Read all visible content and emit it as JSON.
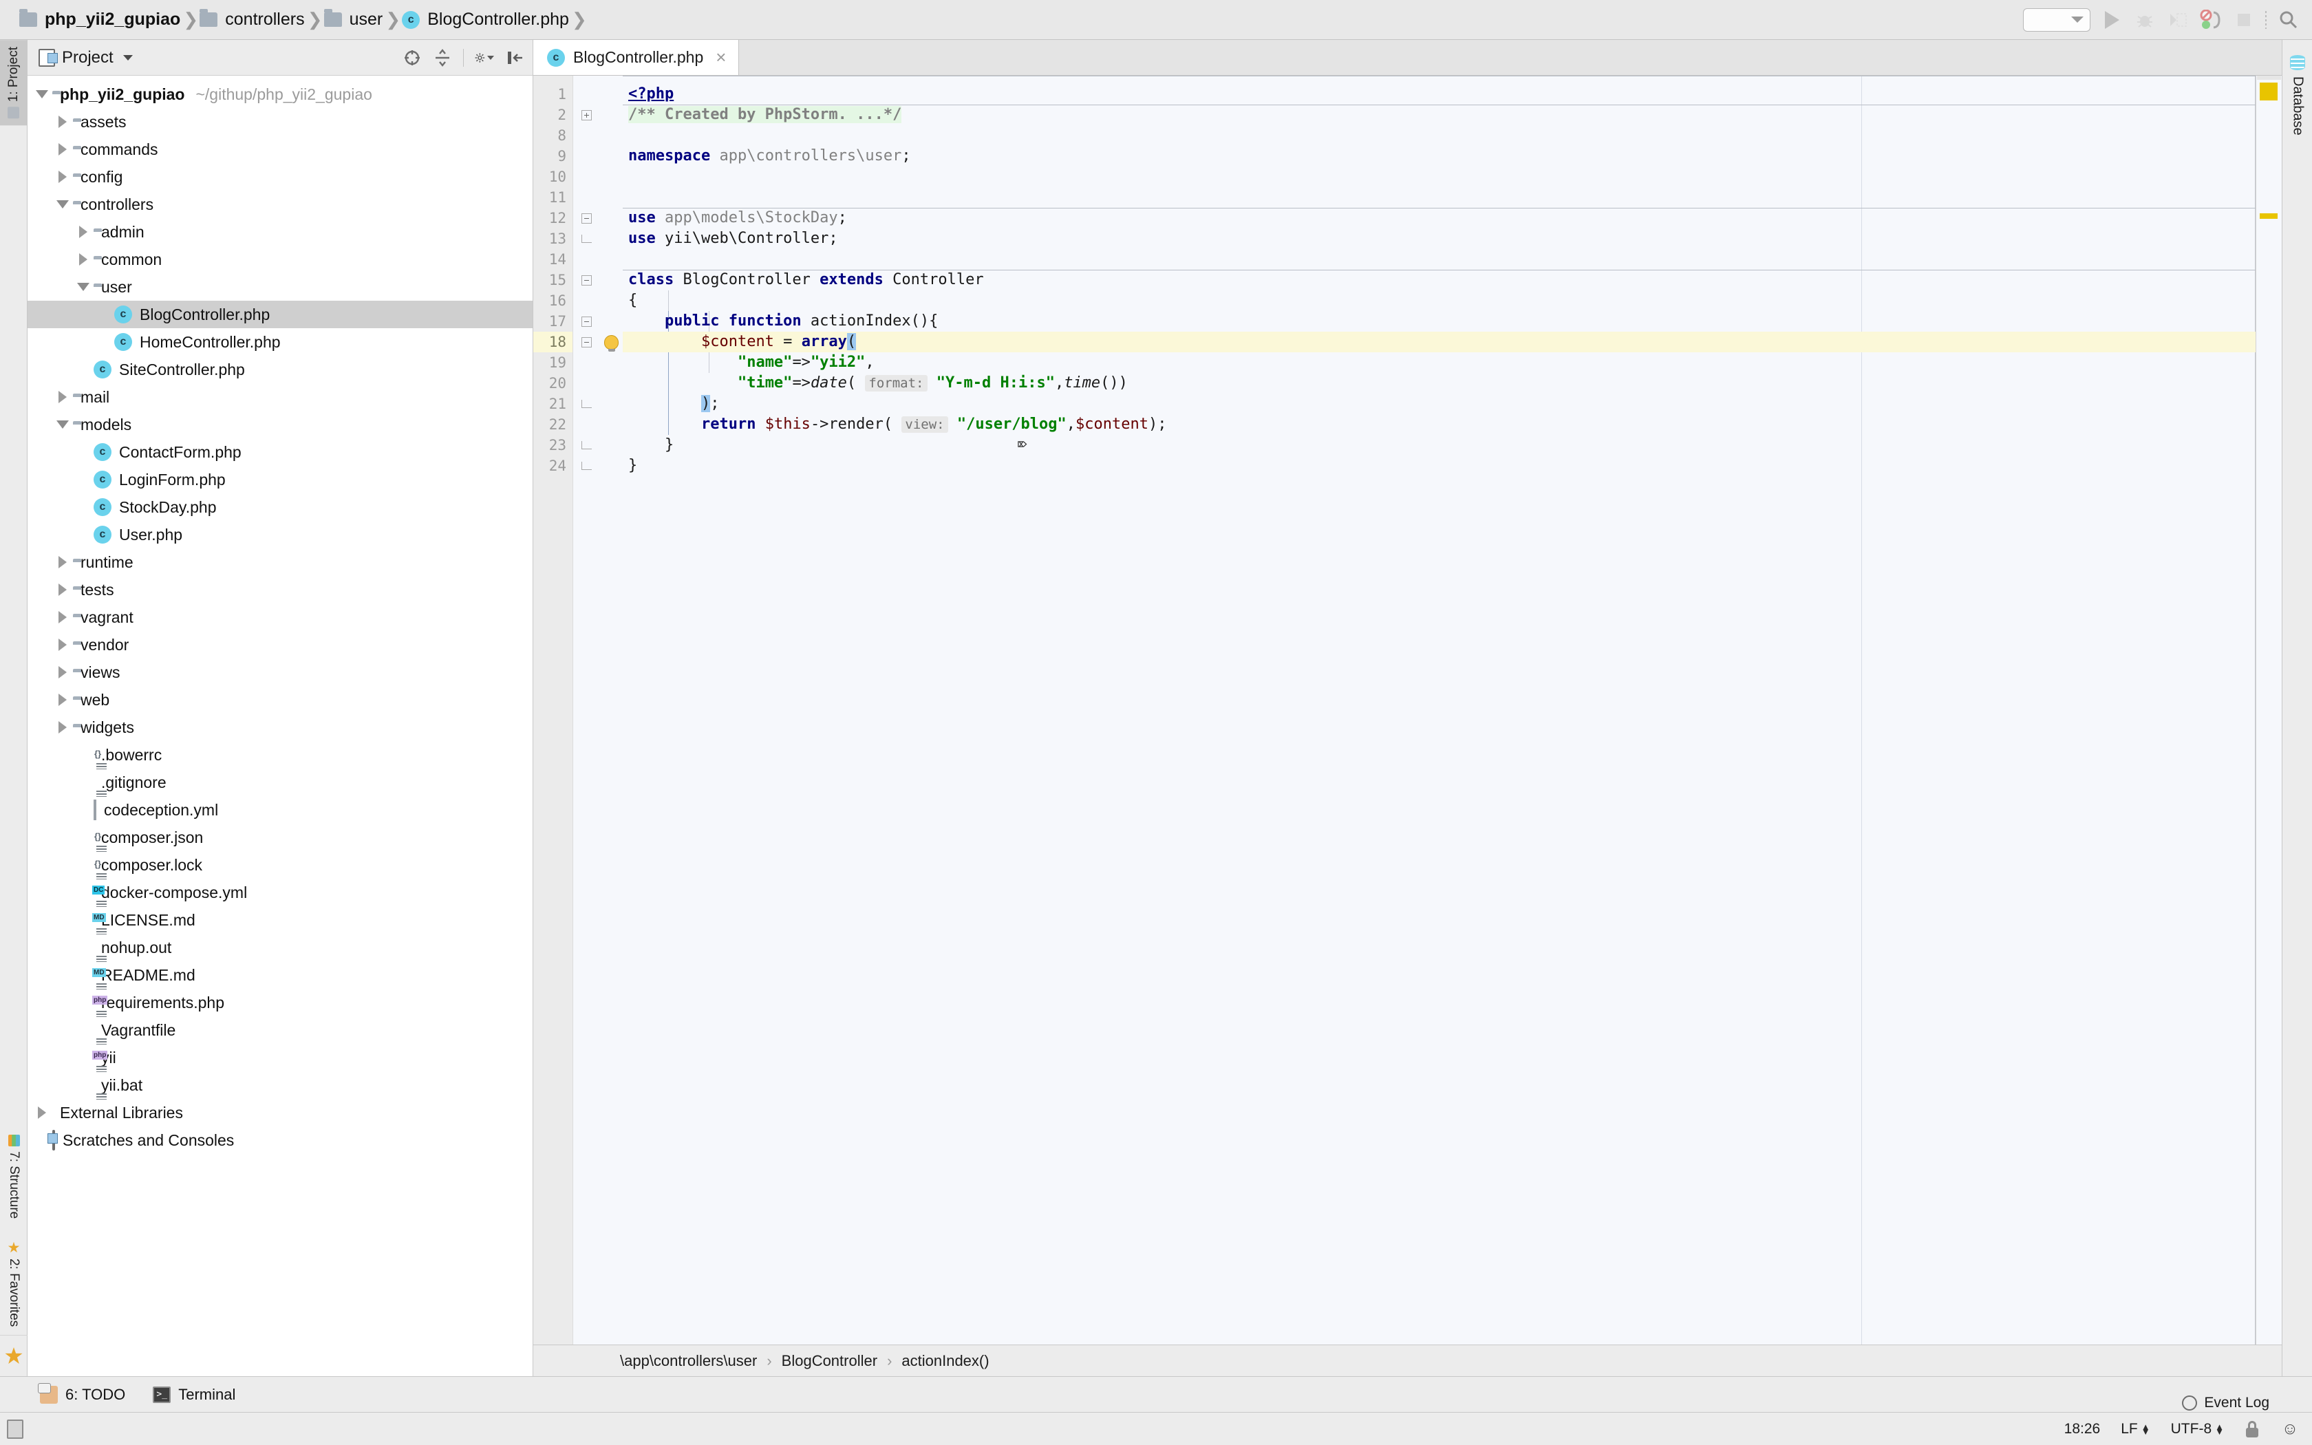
{
  "window": {
    "breadcrumb": [
      {
        "label": "php_yii2_gupiao",
        "icon": "folder-icon",
        "root": true
      },
      {
        "label": "controllers",
        "icon": "folder-icon"
      },
      {
        "label": "user",
        "icon": "folder-icon"
      },
      {
        "label": "BlogController.php",
        "icon": "php-class-icon"
      }
    ]
  },
  "toolbar": {
    "run_config_placeholder": "",
    "buttons": [
      {
        "name": "run-button",
        "label": "Run"
      },
      {
        "name": "debug-button",
        "label": "Debug"
      },
      {
        "name": "run-with-coverage-button",
        "label": "Run with Coverage"
      },
      {
        "name": "stop-debugger-button",
        "label": "Stop Listening for PHP Debug Connections"
      },
      {
        "name": "stop-button",
        "label": "Stop"
      },
      {
        "name": "search-everywhere-button",
        "label": "Search Everywhere"
      }
    ]
  },
  "left_strip": {
    "tabs": [
      {
        "label": "1: Project",
        "icon": "project-icon",
        "active": true
      },
      {
        "label": "7: Structure",
        "icon": "structure-icon",
        "active": false
      },
      {
        "label": "2: Favorites",
        "icon": "favorites-icon",
        "active": false
      }
    ],
    "bookmark_icon": "star-icon"
  },
  "right_strip": {
    "tabs": [
      {
        "label": "Database",
        "icon": "database-icon"
      }
    ]
  },
  "project_panel": {
    "title": "Project",
    "tools": [
      {
        "name": "scroll-from-source-button",
        "label": "Select Opened File"
      },
      {
        "name": "collapse-all-button",
        "label": "Collapse All"
      },
      {
        "name": "settings-gear-button",
        "label": "Settings"
      },
      {
        "name": "hide-panel-button",
        "label": "Hide"
      }
    ],
    "tree": [
      {
        "label": "php_yii2_gupiao",
        "sub": "~/githup/php_yii2_gupiao",
        "indent": 0,
        "twisty": "down",
        "icon": "folder-icon",
        "root": true
      },
      {
        "label": "assets",
        "indent": 1,
        "twisty": "right",
        "icon": "folder-icon"
      },
      {
        "label": "commands",
        "indent": 1,
        "twisty": "right",
        "icon": "folder-icon"
      },
      {
        "label": "config",
        "indent": 1,
        "twisty": "right",
        "icon": "folder-icon"
      },
      {
        "label": "controllers",
        "indent": 1,
        "twisty": "down",
        "icon": "folder-icon"
      },
      {
        "label": "admin",
        "indent": 2,
        "twisty": "right",
        "icon": "folder-icon"
      },
      {
        "label": "common",
        "indent": 2,
        "twisty": "right",
        "icon": "folder-icon"
      },
      {
        "label": "user",
        "indent": 2,
        "twisty": "down",
        "icon": "folder-icon"
      },
      {
        "label": "BlogController.php",
        "indent": 3,
        "twisty": "none",
        "icon": "php-class-icon",
        "selected": true
      },
      {
        "label": "HomeController.php",
        "indent": 3,
        "twisty": "none",
        "icon": "php-class-icon"
      },
      {
        "label": "SiteController.php",
        "indent": 2,
        "twisty": "none",
        "icon": "php-class-icon"
      },
      {
        "label": "mail",
        "indent": 1,
        "twisty": "right",
        "icon": "folder-icon"
      },
      {
        "label": "models",
        "indent": 1,
        "twisty": "down",
        "icon": "folder-icon"
      },
      {
        "label": "ContactForm.php",
        "indent": 2,
        "twisty": "none",
        "icon": "php-class-icon"
      },
      {
        "label": "LoginForm.php",
        "indent": 2,
        "twisty": "none",
        "icon": "php-class-icon"
      },
      {
        "label": "StockDay.php",
        "indent": 2,
        "twisty": "none",
        "icon": "php-class-icon"
      },
      {
        "label": "User.php",
        "indent": 2,
        "twisty": "none",
        "icon": "php-class-icon"
      },
      {
        "label": "runtime",
        "indent": 1,
        "twisty": "right",
        "icon": "folder-icon"
      },
      {
        "label": "tests",
        "indent": 1,
        "twisty": "right",
        "icon": "folder-icon"
      },
      {
        "label": "vagrant",
        "indent": 1,
        "twisty": "right",
        "icon": "folder-icon"
      },
      {
        "label": "vendor",
        "indent": 1,
        "twisty": "right",
        "icon": "folder-icon"
      },
      {
        "label": "views",
        "indent": 1,
        "twisty": "right",
        "icon": "folder-icon"
      },
      {
        "label": "web",
        "indent": 1,
        "twisty": "right",
        "icon": "folder-icon"
      },
      {
        "label": "widgets",
        "indent": 1,
        "twisty": "right",
        "icon": "folder-icon"
      },
      {
        "label": ".bowerrc",
        "indent": 2,
        "twisty": "none",
        "icon": "json-file-icon"
      },
      {
        "label": ".gitignore",
        "indent": 2,
        "twisty": "none",
        "icon": "text-file-icon"
      },
      {
        "label": "codeception.yml",
        "indent": 2,
        "twisty": "none",
        "icon": "yaml-file-icon"
      },
      {
        "label": "composer.json",
        "indent": 2,
        "twisty": "none",
        "icon": "json-file-icon"
      },
      {
        "label": "composer.lock",
        "indent": 2,
        "twisty": "none",
        "icon": "json-file-icon"
      },
      {
        "label": "docker-compose.yml",
        "indent": 2,
        "twisty": "none",
        "icon": "docker-compose-file-icon"
      },
      {
        "label": "LICENSE.md",
        "indent": 2,
        "twisty": "none",
        "icon": "markdown-file-icon"
      },
      {
        "label": "nohup.out",
        "indent": 2,
        "twisty": "none",
        "icon": "text-file-icon"
      },
      {
        "label": "README.md",
        "indent": 2,
        "twisty": "none",
        "icon": "markdown-file-icon"
      },
      {
        "label": "requirements.php",
        "indent": 2,
        "twisty": "none",
        "icon": "php-file-icon"
      },
      {
        "label": "Vagrantfile",
        "indent": 2,
        "twisty": "none",
        "icon": "text-file-icon"
      },
      {
        "label": "yii",
        "indent": 2,
        "twisty": "none",
        "icon": "php-file-icon"
      },
      {
        "label": "yii.bat",
        "indent": 2,
        "twisty": "none",
        "icon": "text-file-icon"
      },
      {
        "label": "External Libraries",
        "indent": 0,
        "twisty": "right",
        "icon": "libraries-icon"
      },
      {
        "label": "Scratches and Consoles",
        "indent": 0,
        "twisty": "none",
        "icon": "scratches-icon"
      }
    ]
  },
  "editor": {
    "tabs": [
      {
        "label": "BlogController.php",
        "icon": "php-class-icon",
        "active": true,
        "close": "×"
      }
    ],
    "line_numbers": [
      "1",
      "2",
      "8",
      "9",
      "10",
      "11",
      "12",
      "13",
      "14",
      "15",
      "16",
      "17",
      "18",
      "19",
      "20",
      "21",
      "22",
      "23",
      "24"
    ],
    "current_line": "18",
    "breadcrumb": [
      "\\app\\controllers\\user",
      "BlogController",
      "actionIndex()"
    ],
    "breadcrumb_sep": "›",
    "code_lines": [
      "<?php",
      "/** Created by PhpStorm. ...*/",
      "",
      "namespace app\\controllers\\user;",
      "",
      "",
      "use app\\models\\StockDay;",
      "use yii\\web\\Controller;",
      "",
      "class BlogController extends Controller",
      "{",
      "    public function actionIndex(){",
      "        $content = array(",
      "            \"name\"=>\"yii2\",",
      "            \"time\"=>date( format: \"Y-m-d H:i:s\",time())",
      "        );",
      "        return $this->render( view: \"/user/blog\",$content);",
      "    }",
      "}"
    ],
    "inlay_hints": [
      "format:",
      "view:"
    ]
  },
  "tool_window_bar": {
    "items": [
      {
        "label": "6: TODO",
        "shortcut": "6",
        "icon": "todo-icon"
      },
      {
        "label": "Terminal",
        "icon": "terminal-icon"
      }
    ]
  },
  "status_bar": {
    "time": "18:26",
    "line_separator": "LF",
    "encoding": "UTF-8",
    "lock": "lock-icon",
    "event_log": "Event Log"
  }
}
